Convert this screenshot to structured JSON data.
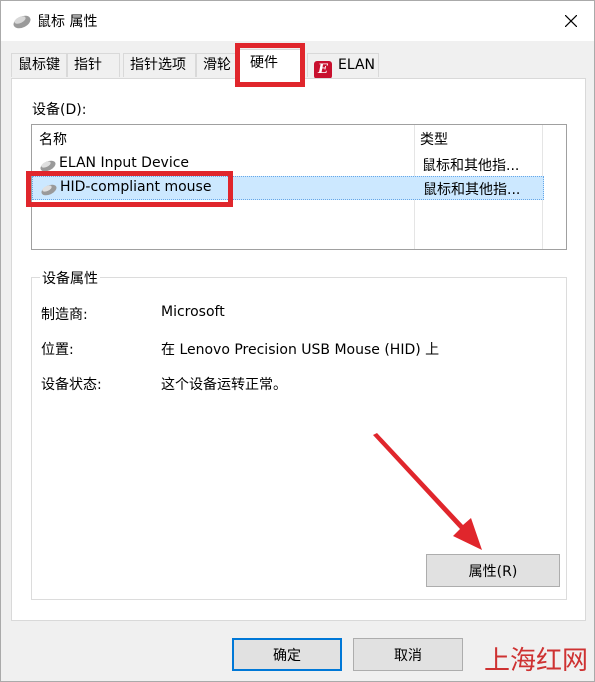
{
  "window": {
    "title": "鼠标 属性"
  },
  "tabs": [
    {
      "label": "鼠标键"
    },
    {
      "label": "指针"
    },
    {
      "label": "指针选项"
    },
    {
      "label": "滑轮"
    },
    {
      "label": "硬件"
    },
    {
      "label": "ELAN"
    }
  ],
  "devices": {
    "label": "设备(D):",
    "columns": [
      "名称",
      "类型"
    ],
    "rows": [
      {
        "name": "ELAN Input Device",
        "type": "鼠标和其他指..."
      },
      {
        "name": "HID-compliant mouse",
        "type": "鼠标和其他指..."
      }
    ]
  },
  "device_properties": {
    "title": "设备属性",
    "fields": [
      {
        "label": "制造商:",
        "value": "Microsoft"
      },
      {
        "label": "位置:",
        "value": "在 Lenovo Precision USB Mouse (HID) 上"
      },
      {
        "label": "设备状态:",
        "value": "这个设备运转正常。"
      }
    ],
    "button_label": "属性(R)"
  },
  "footer": {
    "ok_label": "确定",
    "cancel_label": "取消"
  },
  "watermark": "上海红网",
  "colors": {
    "highlight": "#e0262c",
    "selection": "#cce8ff",
    "accent": "#0078d7"
  }
}
